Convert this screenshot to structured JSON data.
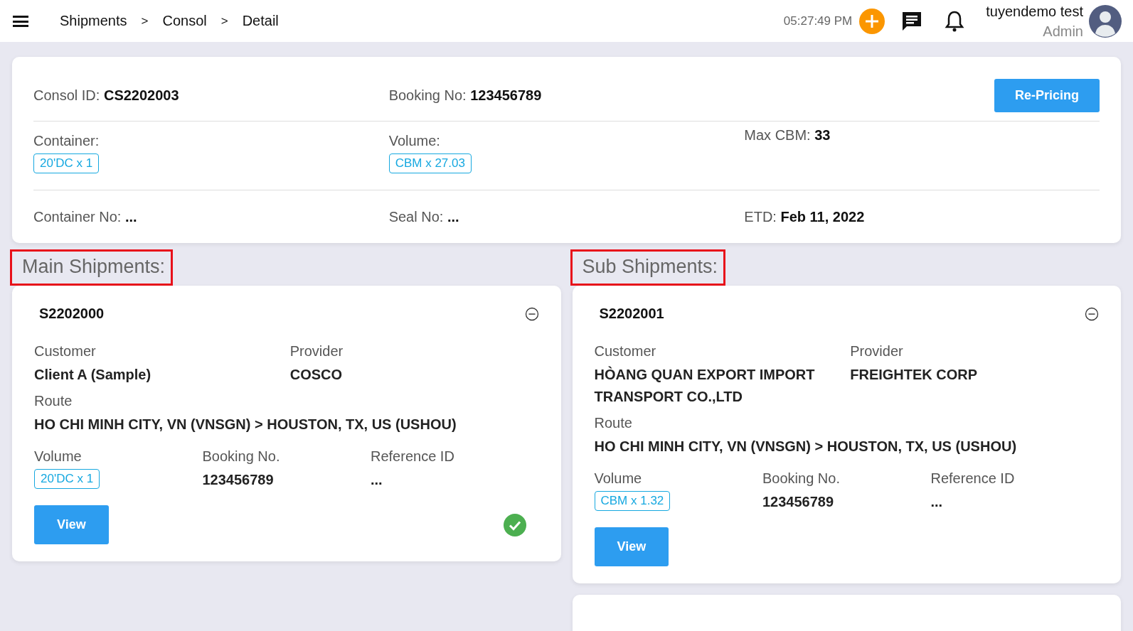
{
  "header": {
    "breadcrumbs": [
      {
        "label": "Shipments"
      },
      {
        "label": "Consol"
      },
      {
        "label": "Detail"
      }
    ],
    "separators": [
      ">",
      ">"
    ],
    "time": "05:27:49 PM",
    "user": {
      "name": "tuyendemo test",
      "role": "Admin"
    }
  },
  "consol": {
    "fields": [
      {
        "label": "Consol ID:",
        "value": "CS2202003",
        "kind": "inline"
      },
      {
        "label": "Booking No:",
        "value": "123456789",
        "kind": "inline"
      },
      {
        "kind": "button",
        "label": "Re-Pricing"
      },
      {
        "label": "Container:",
        "value": "20'DC x 1",
        "kind": "tag"
      },
      {
        "label": "Volume:",
        "value": "CBM x 27.03",
        "kind": "tag"
      },
      {
        "label": "Max CBM:",
        "value": "33",
        "kind": "inline"
      },
      {
        "label": "Container No:",
        "value": "...",
        "kind": "inline"
      },
      {
        "label": "Seal No:",
        "value": "...",
        "kind": "inline"
      },
      {
        "label": "ETD:",
        "value": "Feb 11, 2022",
        "kind": "inline"
      }
    ]
  },
  "sections": [
    {
      "title": "Main Shipments:",
      "highlighted": true,
      "shipments": [
        {
          "id": "S2202000",
          "customer_label": "Customer",
          "customer": "Client A (Sample)",
          "provider_label": "Provider",
          "provider": "COSCO",
          "route_label": "Route",
          "route": "HO CHI MINH CITY, VN (VNSGN) > HOUSTON, TX, US (USHOU)",
          "volume_label": "Volume",
          "volume": "20'DC x 1",
          "booking_label": "Booking No.",
          "booking": "123456789",
          "reference_label": "Reference ID",
          "reference": "...",
          "button": "View",
          "confirmed": true
        }
      ]
    },
    {
      "title": "Sub Shipments:",
      "highlighted": true,
      "shipments": [
        {
          "id": "S2202001",
          "customer_label": "Customer",
          "customer": "HÒANG QUAN EXPORT IMPORT TRANSPORT CO.,LTD",
          "provider_label": "Provider",
          "provider": "FREIGHTEK CORP",
          "route_label": "Route",
          "route": "HO CHI MINH CITY, VN (VNSGN) > HOUSTON, TX, US (USHOU)",
          "volume_label": "Volume",
          "volume": "CBM x 1.32",
          "booking_label": "Booking No.",
          "booking": "123456789",
          "reference_label": "Reference ID",
          "reference": "...",
          "button": "View",
          "confirmed": false
        },
        {
          "kind": "cut_off"
        }
      ]
    }
  ]
}
